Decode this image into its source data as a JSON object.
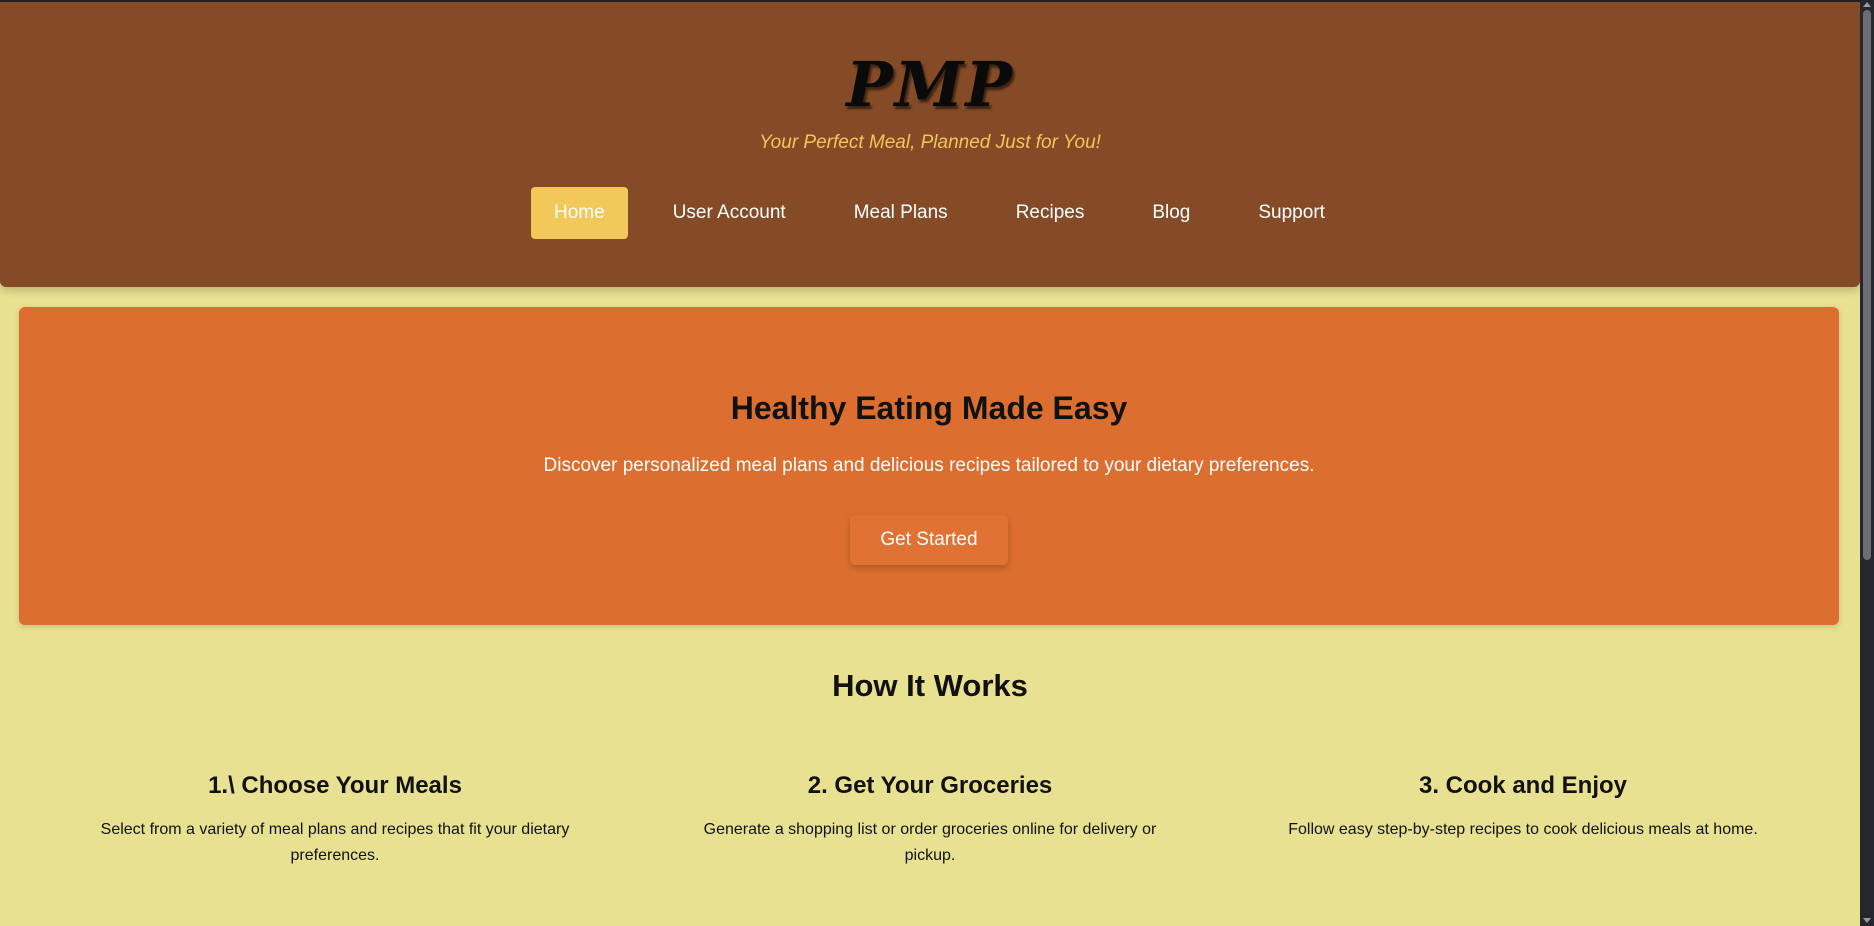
{
  "header": {
    "logo": "PMP",
    "tagline": "Your Perfect Meal, Planned Just for You!",
    "nav": [
      {
        "label": "Home",
        "active": true
      },
      {
        "label": "User Account",
        "active": false
      },
      {
        "label": "Meal Plans",
        "active": false
      },
      {
        "label": "Recipes",
        "active": false
      },
      {
        "label": "Blog",
        "active": false
      },
      {
        "label": "Support",
        "active": false
      }
    ]
  },
  "hero": {
    "title": "Healthy Eating Made Easy",
    "text": "Discover personalized meal plans and delicious recipes tailored to your dietary preferences.",
    "cta_label": "Get Started"
  },
  "how_it_works": {
    "title": "How It Works",
    "steps": [
      {
        "title": "1.\\ Choose Your Meals",
        "description": "Select from a variety of meal plans and recipes that fit your dietary preferences."
      },
      {
        "title": "2. Get Your Groceries",
        "description": "Generate a shopping list or order groceries online for delivery or pickup."
      },
      {
        "title": "3. Cook and Enjoy",
        "description": "Follow easy step-by-step recipes to cook delicious meals at home."
      }
    ]
  },
  "colors": {
    "page_background": "#e8e192",
    "header_background": "#844b26",
    "tagline": "#f3c55a",
    "nav_active": "#f3c85b",
    "hero_background": "#dc6f30",
    "cta_background": "#e07333"
  }
}
